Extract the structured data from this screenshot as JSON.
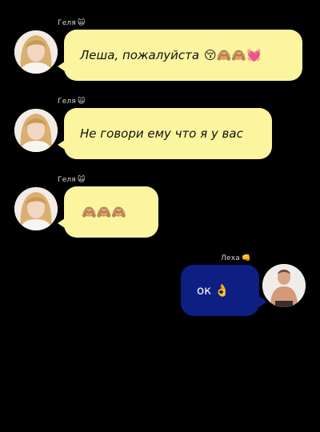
{
  "messages": [
    {
      "sender": "Геля",
      "sender_badge": "🙀",
      "text": "Леша, пожалуйста",
      "emoji": "😚🙈🙈💓",
      "side": "left"
    },
    {
      "sender": "Геля",
      "sender_badge": "🙀",
      "text": "Не говори ему что я у вас",
      "emoji": "",
      "side": "left"
    },
    {
      "sender": "Геля",
      "sender_badge": "🙀",
      "text": "",
      "emoji": "🙈🙈🙈",
      "side": "left"
    },
    {
      "sender": "Леха",
      "sender_badge": "👊",
      "text": "ок",
      "emoji": "👌",
      "side": "right"
    }
  ],
  "colors": {
    "background": "#000000",
    "incoming_bubble": "#fcf5a0",
    "outgoing_bubble": "#0d1f82"
  },
  "icons": {
    "incoming_avatar": "girl-avatar",
    "outgoing_avatar": "boy-avatar"
  }
}
